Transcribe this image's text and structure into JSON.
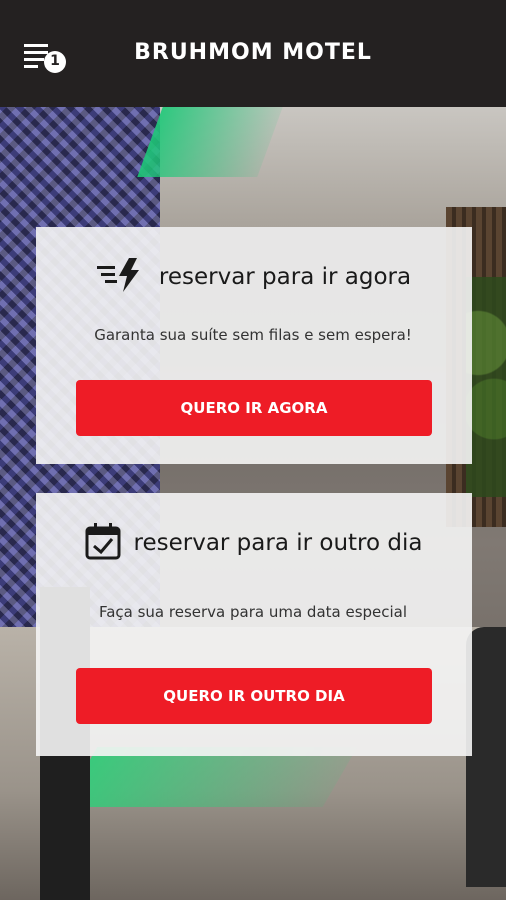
{
  "header": {
    "title": "BRUHMOM MOTEL",
    "menu_badge": "1",
    "menu_icon": "menu-list-icon"
  },
  "now_card": {
    "icon": "fast-lightning-icon",
    "title": "reservar para ir agora",
    "subtitle": "Garanta sua suíte sem filas e sem espera!",
    "button_label": "QUERO IR AGORA"
  },
  "later_card": {
    "icon": "calendar-check-icon",
    "title": "reservar para ir outro dia",
    "subtitle": "Faça sua reserva para uma data especial",
    "button_label": "QUERO IR OUTRO DIA"
  },
  "colors": {
    "topbar": "#242121",
    "accent": "#ee1c26",
    "card": "#f5f5f5"
  }
}
